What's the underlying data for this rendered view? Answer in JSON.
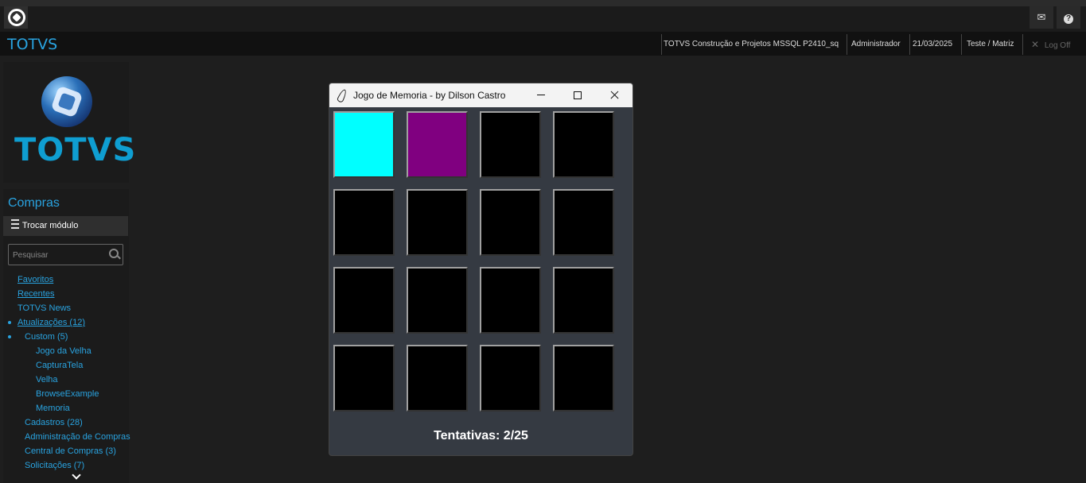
{
  "header": {
    "brand": "TOTVS",
    "environment": "TOTVS Construção e Projetos MSSQL P2410_sq",
    "user": "Administrador",
    "date": "21/03/2025",
    "company": "Teste / Matriz",
    "logoff": "Log Off"
  },
  "topbar": {
    "mail_icon": "mail-icon",
    "help_icon": "help-icon"
  },
  "sidebar": {
    "logo_text": "TOTVS",
    "module_title": "Compras",
    "switch_module": "Trocar módulo",
    "search_placeholder": "Pesquisar",
    "items": [
      {
        "label": "Favoritos"
      },
      {
        "label": "Recentes"
      },
      {
        "label": "TOTVS News"
      },
      {
        "label": "Atualizações (12)"
      },
      {
        "label": "Custom (5)"
      },
      {
        "label": "Jogo da Velha"
      },
      {
        "label": "CapturaTela"
      },
      {
        "label": "Velha"
      },
      {
        "label": "BrowseExample"
      },
      {
        "label": "Memoria"
      },
      {
        "label": "Cadastros (28)"
      },
      {
        "label": "Administração de Compras"
      },
      {
        "label": "Central de Compras (3)"
      },
      {
        "label": "Solicitações (7)"
      }
    ]
  },
  "game_window": {
    "title": "Jogo de Memoria - by Dilson Castro",
    "cards": [
      "#00ffff",
      "#800080",
      "#000000",
      "#000000",
      "#000000",
      "#000000",
      "#000000",
      "#000000",
      "#000000",
      "#000000",
      "#000000",
      "#000000",
      "#000000",
      "#000000",
      "#000000",
      "#000000"
    ],
    "status": "Tentativas: 2/25"
  },
  "colors": {
    "accent": "#29a3e0",
    "window_bg": "#353a42"
  }
}
